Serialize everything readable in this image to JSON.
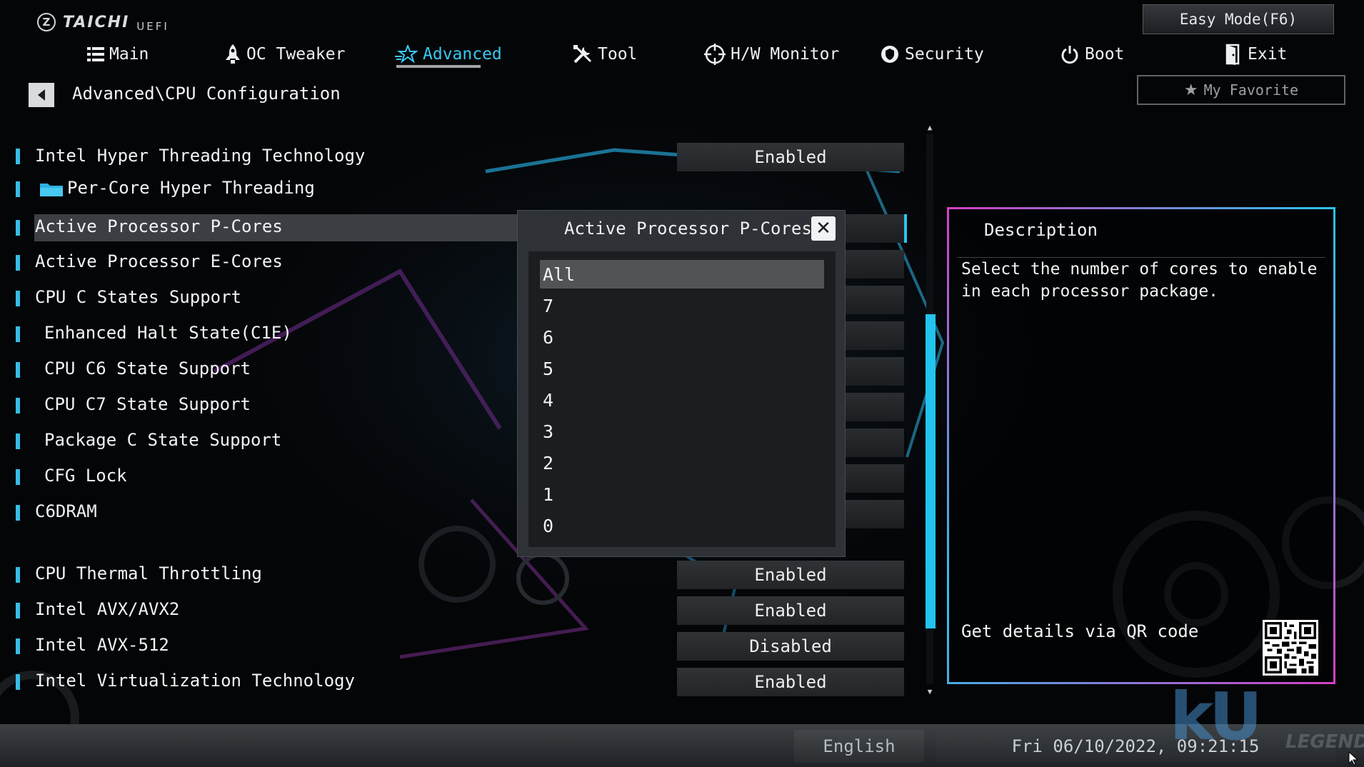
{
  "brand": {
    "name": "TAICHI",
    "sub": "UEFI"
  },
  "header": {
    "easy_mode": "Easy Mode(F6)",
    "my_favorite": "My Favorite",
    "tabs": [
      {
        "label": "Main",
        "icon": "list-icon"
      },
      {
        "label": "OC Tweaker",
        "icon": "rocket-icon"
      },
      {
        "label": "Advanced",
        "icon": "star-icon",
        "active": true
      },
      {
        "label": "Tool",
        "icon": "tools-icon"
      },
      {
        "label": "H/W Monitor",
        "icon": "crosshair-icon"
      },
      {
        "label": "Security",
        "icon": "shield-icon"
      },
      {
        "label": "Boot",
        "icon": "power-icon"
      },
      {
        "label": "Exit",
        "icon": "exit-door-icon"
      }
    ]
  },
  "breadcrumb": "Advanced\\CPU Configuration",
  "settings": [
    {
      "label": "Intel Hyper Threading Technology",
      "value": "Enabled"
    },
    {
      "label": "Per-Core Hyper Threading",
      "value": ""
    },
    {
      "label": "Active Processor P-Cores",
      "value": "All"
    },
    {
      "label": "Active Processor E-Cores",
      "value": ""
    },
    {
      "label": "CPU C States Support",
      "value": ""
    },
    {
      "label": "Enhanced Halt State(C1E)",
      "value": ""
    },
    {
      "label": "CPU C6 State Support",
      "value": ""
    },
    {
      "label": "CPU C7 State Support",
      "value": ""
    },
    {
      "label": "Package C State Support",
      "value": ""
    },
    {
      "label": "CFG Lock",
      "value": ""
    },
    {
      "label": "C6DRAM",
      "value": ""
    },
    {
      "label": "CPU Thermal Throttling",
      "value": "Enabled"
    },
    {
      "label": "Intel AVX/AVX2",
      "value": "Enabled"
    },
    {
      "label": "Intel AVX-512",
      "value": "Disabled"
    },
    {
      "label": "Intel Virtualization Technology",
      "value": "Enabled"
    }
  ],
  "modal": {
    "title": "Active Processor P-Cores",
    "options": [
      "All",
      "7",
      "6",
      "5",
      "4",
      "3",
      "2",
      "1",
      "0"
    ],
    "selected_index": 0
  },
  "description": {
    "title": "Description",
    "text": "Select the number of cores to enable in each processor package.",
    "qr_label": "Get details via QR code"
  },
  "footer": {
    "language": "English",
    "datetime": "Fri 06/10/2022, 09:21:15"
  },
  "watermark": {
    "main": "kU",
    "sub": "LEGEND"
  },
  "colors": {
    "accent": "#2bc4ee",
    "panel_border_pink": "#d43fc5",
    "highlight": "#3b3f43",
    "value_box": "#2a2d30"
  }
}
